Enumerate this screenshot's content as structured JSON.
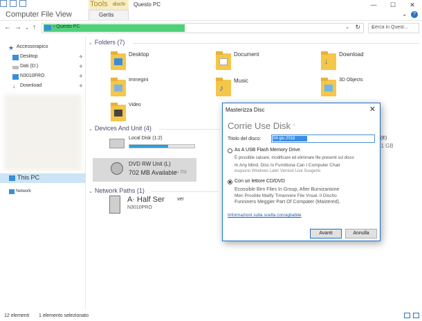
{
  "window": {
    "app_title": "Computer File View",
    "tools_tab": "Tools",
    "tools_sub": "dischi",
    "ribbon_tab": "Gertis",
    "caption": "Questo PC",
    "controls": [
      "—",
      "☐",
      "✕"
    ]
  },
  "nav": {
    "breadcrumb": "Questo PC",
    "search_placeholder": "Cerca in Quest..."
  },
  "sidebar": {
    "items": [
      {
        "label": "Accessorapico",
        "icon": "star-icon"
      },
      {
        "label": "Desktop",
        "icon": "desktop-icon"
      },
      {
        "label": "Dati (D:)",
        "icon": "drive-icon"
      },
      {
        "label": "N3010FRO",
        "icon": "computer-icon"
      },
      {
        "label": "Download",
        "icon": "download-icon"
      },
      {
        "label": "This PC",
        "icon": "pc-icon"
      },
      {
        "label": "Network",
        "icon": "network-icon"
      }
    ]
  },
  "folders": {
    "header": "Folders (7)",
    "items": [
      {
        "label": "Desktop"
      },
      {
        "label": "Document"
      },
      {
        "label": "Download"
      },
      {
        "label": "Immegini"
      },
      {
        "label": "Music"
      },
      {
        "label": "3D Objects"
      },
      {
        "label": "Video"
      }
    ]
  },
  "devices": {
    "header": "Devices And Unit (4)",
    "local_disk": {
      "label": "Local Disk (1:2)",
      "fill_fraction": 0.6
    },
    "dvd": {
      "label": "DVD RW Unit (L)",
      "free": "702 MB Available",
      "total": "su 702"
    },
    "right_drive": {
      "label": "(E)",
      "size": "31 GB"
    }
  },
  "network": {
    "header": "Network Paths (1)",
    "item_label": "A· Half Ser",
    "item_suffix": "ver",
    "item_sub": "N3010PRO"
  },
  "status": {
    "count": "12 elementi",
    "selected": "1 elemento selezionato"
  },
  "dialog": {
    "title": "Masterizza Disc",
    "heading": "Corrie Use Disk",
    "field_label": "Titolo del disco:",
    "field_value": "04 giu 2018",
    "option1": {
      "label": "As A USB Flash Memory Drive",
      "desc1": "È possibile salvare, modificare ed eliminare file presenti sul disco",
      "desc2": "In Any Mind. Disc Is Furnitiona Can I Computer Chair",
      "desc3": "esquono Windows Later Version Live Suugenii."
    },
    "option2": {
      "label": "Con un lettore CD/DVD",
      "desc1": "Ecossible Birn Files In Group, After Burnizanione",
      "desc2": "Men Prosible Mailfy Timanvere File Vnsal. Il Discho",
      "desc3": "Funniners Meggier Part Of Compater (Mastered)."
    },
    "link": "Informazioni sulla scelta consigliabile",
    "ok_label": "Avanti",
    "cancel_label": "Annulla",
    "close_glyph": "✕"
  },
  "colors": {
    "accent": "#1f6fc2",
    "address_highlight": "#4fd17a",
    "folder": "#f5c64a",
    "tools_tab": "#f7edc1"
  }
}
